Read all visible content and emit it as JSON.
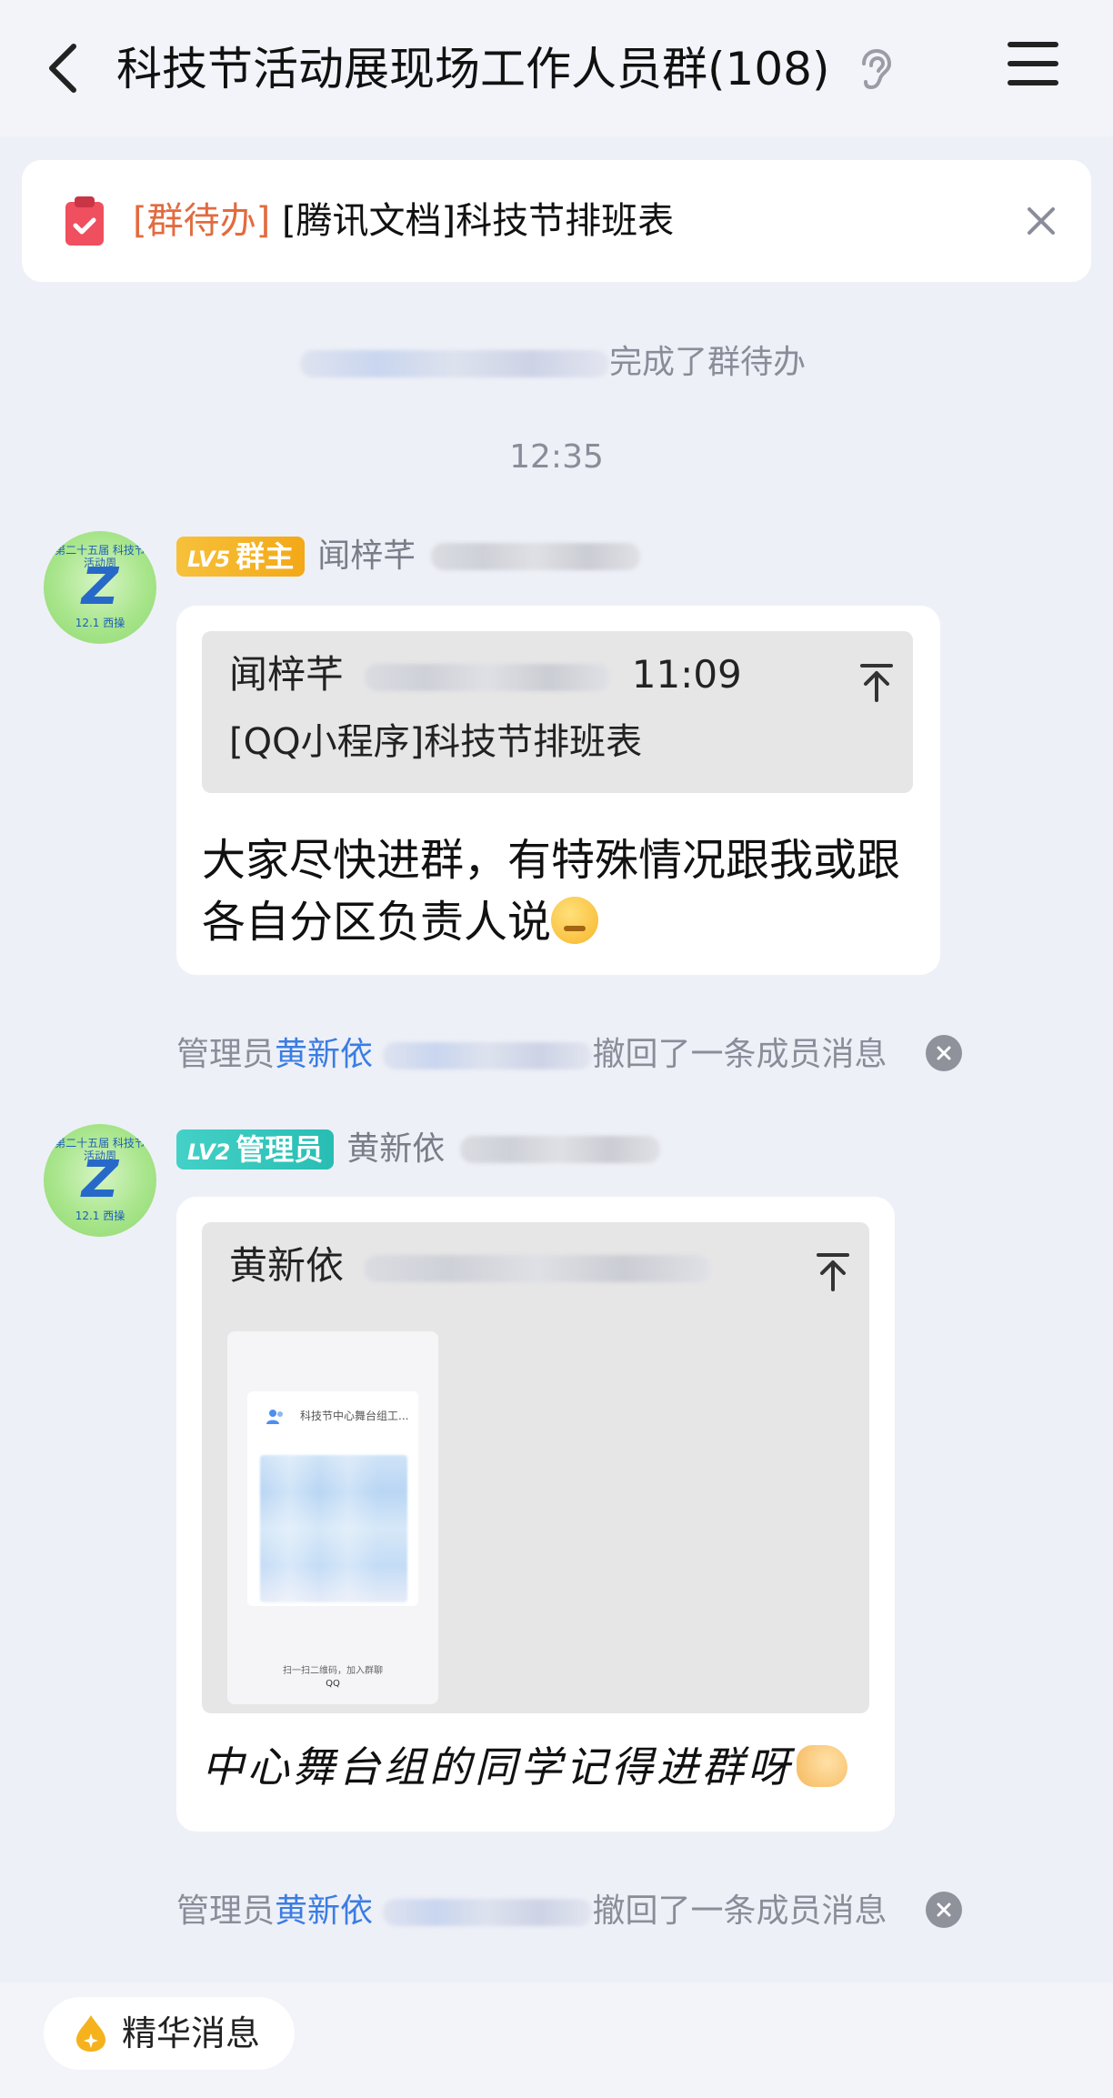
{
  "header": {
    "title": "科技节活动展现场工作人员群(108)",
    "back_icon": "back-arrow-icon",
    "ear_icon": "ear-icon",
    "menu_icon": "menu-icon"
  },
  "todo_banner": {
    "tag": "[群待办]",
    "text": "[腾讯文档]科技节排班表"
  },
  "system_notice": {
    "suffix": "完成了群待办"
  },
  "timestamp": "12:35",
  "messages": [
    {
      "level": "LV5",
      "role": "群主",
      "sender": "闻梓芊",
      "quote": {
        "name": "闻梓芊",
        "time": "11:09",
        "text": "[QQ小程序]科技节排班表"
      },
      "text": "大家尽快进群，有特殊情况跟我或跟各自分区负责人说"
    },
    {
      "level": "LV2",
      "role": "管理员",
      "sender": "黄新依",
      "quote": {
        "name": "黄新依",
        "card_title": "科技节中心舞台组工...",
        "card_caption": "扫一扫二维码，加入群聊",
        "card_brand": "QQ"
      },
      "text": "中心舞台组的同学记得进群呀"
    }
  ],
  "recall_notices": [
    {
      "prefix": "管理员",
      "admin": "黄新依",
      "suffix": "撤回了一条成员消息"
    },
    {
      "prefix": "管理员",
      "admin": "黄新依",
      "suffix": "撤回了一条成员消息"
    }
  ],
  "bottom_bar": {
    "essence_label": "精华消息"
  },
  "avatar": {
    "top_text": "第二十五届 科技节活动周",
    "letter": "Z",
    "bottom_text": "12.1 西操"
  },
  "colors": {
    "todo_tag": "#e26b3f",
    "admin_link": "#3b7de3",
    "owner_badge": "#f3a817",
    "admin_badge": "#28bdb3",
    "background": "#eef0f7"
  }
}
